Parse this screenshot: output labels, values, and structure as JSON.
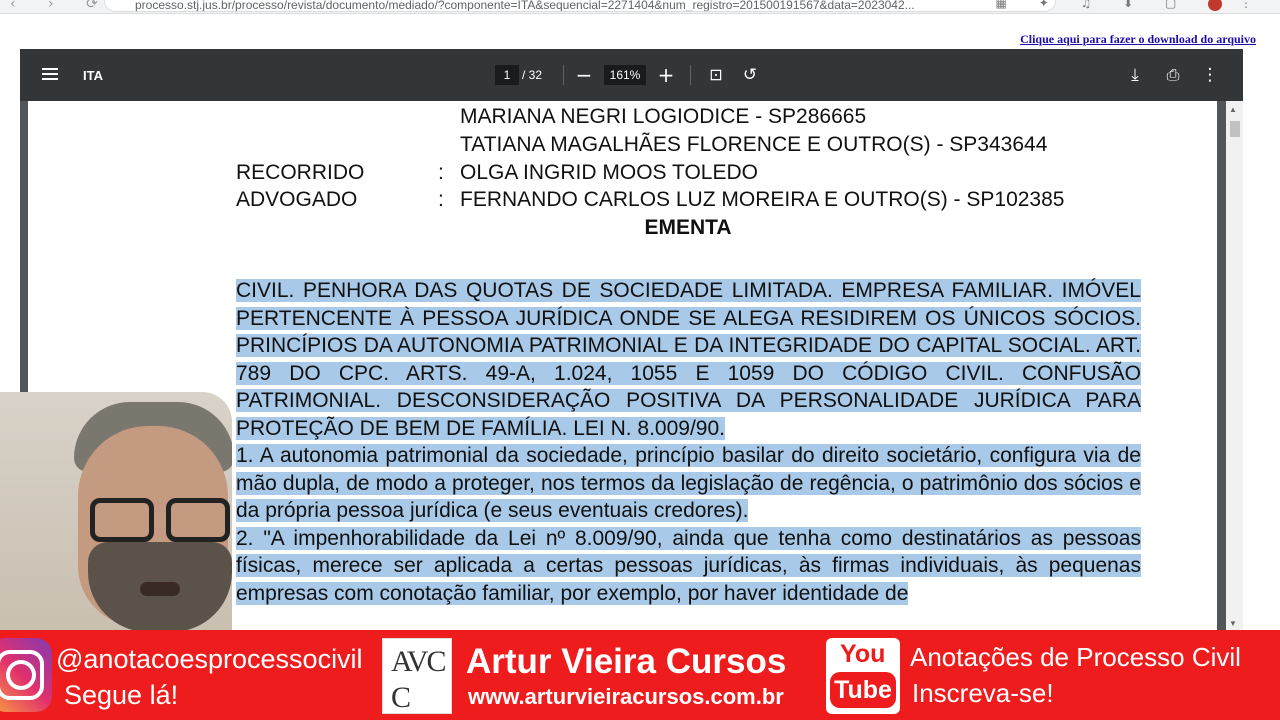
{
  "browser": {
    "url": "processo.stj.jus.br/processo/revista/documento/mediado/?componente=ITA&sequencial=2271404&num_registro=201500191567&data=2023042..."
  },
  "download_link": "Clique aqui para fazer o download do arquivo",
  "pdf_toolbar": {
    "title": "ITA",
    "current_page": "1",
    "total_pages": "/ 32",
    "zoom": "161%"
  },
  "document": {
    "lawyers_line1": "MARIANA NEGRI LOGIODICE  - SP286665",
    "lawyers_line2": "TATIANA MAGALHÃES FLORENCE E OUTRO(S) - SP343644",
    "recorrido_label": "RECORRIDO",
    "recorrido_value": "OLGA INGRID MOOS TOLEDO",
    "advogado_label": "ADVOGADO",
    "advogado_value": "FERNANDO CARLOS LUZ MOREIRA E OUTRO(S) - SP102385",
    "colon": ":",
    "ementa_title": "EMENTA",
    "ementa_summary": "CIVIL. PENHORA DAS QUOTAS DE SOCIEDADE LIMITADA. EMPRESA FAMILIAR. IMÓVEL PERTENCENTE À PESSOA JURÍDICA ONDE SE ALEGA RESIDIREM OS ÚNICOS SÓCIOS. PRINCÍPIOS DA AUTONOMIA PATRIMONIAL E DA INTEGRIDADE DO CAPITAL SOCIAL. ART. 789 DO CPC. ARTS. 49-A, 1.024, 1055 E 1059 DO CÓDIGO CIVIL. CONFUSÃO PATRIMONIAL. DESCONSIDERAÇÃO POSITIVA DA PERSONALIDADE JURÍDICA PARA PROTEÇÃO DE BEM DE FAMÍLIA. LEI N. 8.009/90.",
    "item1": "1. A autonomia patrimonial da sociedade, princípio basilar do direito societário, configura via de mão dupla, de modo a proteger, nos termos da legislação de regência, o patrimônio dos sócios e da própria pessoa jurídica (e seus eventuais credores).",
    "item2": "2. \"A impenhorabilidade da Lei nº 8.009/90, ainda que tenha como destinatários as pessoas físicas, merece ser aplicada a certas pessoas jurídicas, às firmas individuais, às pequenas empresas com conotação familiar, por exemplo, por haver identidade de"
  },
  "banner": {
    "instagram_handle": "@anotacoesprocessocivil",
    "instagram_cta": "Segue lá!",
    "logo_letters_top": "AVC",
    "logo_letters_bottom": "C",
    "brand_name": "Artur Vieira Cursos",
    "brand_url": "www.arturvieiracursos.com.br",
    "youtube_you": "You",
    "youtube_tube": "Tube",
    "youtube_channel": "Anotações de Processo Civil",
    "youtube_cta": "Inscreva-se!"
  },
  "colors": {
    "banner_red": "#ee1c1c",
    "highlight": "#a9c9e8",
    "toolbar": "#323639"
  }
}
